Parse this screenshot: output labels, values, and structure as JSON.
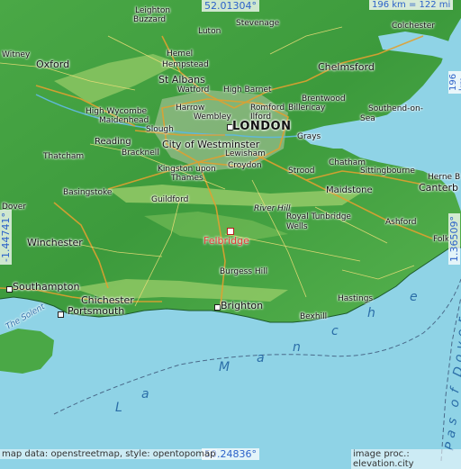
{
  "colors": {
    "sea": "#8fd3e6",
    "land_low": "#3c9a3c",
    "land_high": "#9acd6a",
    "highlight": "#e53935",
    "coord_text": "#2c62c9"
  },
  "coords": {
    "top_lat": "52.01304°",
    "bottom_lat": "50.24836°",
    "left_lon": "-1.44741°",
    "right_lon": "1.36509°"
  },
  "scales": {
    "top": "196 km = 122 mi",
    "right": "196 km = 122 mi"
  },
  "credits": {
    "left": "map data: openstreetmap, style: opentopomap",
    "right": "image proc.: elevation.city"
  },
  "highlight_place": "Felbridge",
  "cities": {
    "london": "LONDON",
    "westminster": "City of Westminster",
    "brighton": "Brighton",
    "southampton": "Southampton",
    "portsmouth": "Portsmouth",
    "chelmsford": "Chelmsford",
    "oxford": "Oxford",
    "reading": "Reading",
    "winchester": "Winchester",
    "maidstone": "Maidstone"
  },
  "towns": {
    "luton": "Luton",
    "stevenage": "Stevenage",
    "hemel": "Hemel",
    "hempstead": "Hempstead",
    "st_albans": "St Albans",
    "watford": "Watford",
    "high_barnet": "High Barnet",
    "harrow": "Harrow",
    "wembley": "Wembley",
    "romford": "Romford",
    "ilford": "Ilford",
    "brentwood": "Brentwood",
    "billericay": "Billericay",
    "southend": "Southend-on-",
    "southend2": "Sea",
    "colchester": "Colchester",
    "high_wycombe": "High Wycombe",
    "maidenhead": "Maidenhead",
    "slough": "Slough",
    "bracknell": "Bracknell",
    "thatcham": "Thatcham",
    "basingstoke": "Basingstoke",
    "guildford": "Guildford",
    "kingston": "Kingston upon",
    "thames": "Thames",
    "croydon": "Croydon",
    "lewisham": "Lewisham",
    "grays": "Grays",
    "strood": "Strood",
    "chatham": "Chatham",
    "sittingbourne": "Sittingbourne",
    "herne_bay": "Herne B",
    "canterbury": "Canterb",
    "royal_tunbridge": "Royal Tunbridge",
    "wells": "Wells",
    "ashford": "Ashford",
    "folk": "Folk",
    "burgess_hill": "Burgess Hill",
    "hastings": "Hastings",
    "bexhill": "Bexhill",
    "chichester": "Chichester",
    "buzzard": "Buzzard",
    "leighton": "Leighton",
    "witney": "Witney",
    "dover": "Dover"
  },
  "features": {
    "river_hill": "River Hill",
    "the_solent": "The Solent",
    "la_manche": [
      "L",
      "a",
      "M",
      "a",
      "n",
      "c",
      "h",
      "e"
    ],
    "pas_de_calais": [
      "P",
      "a",
      "s",
      " ",
      "o",
      "f",
      " ",
      "D",
      "o",
      "v",
      "e",
      "r",
      " ",
      "-"
    ]
  }
}
